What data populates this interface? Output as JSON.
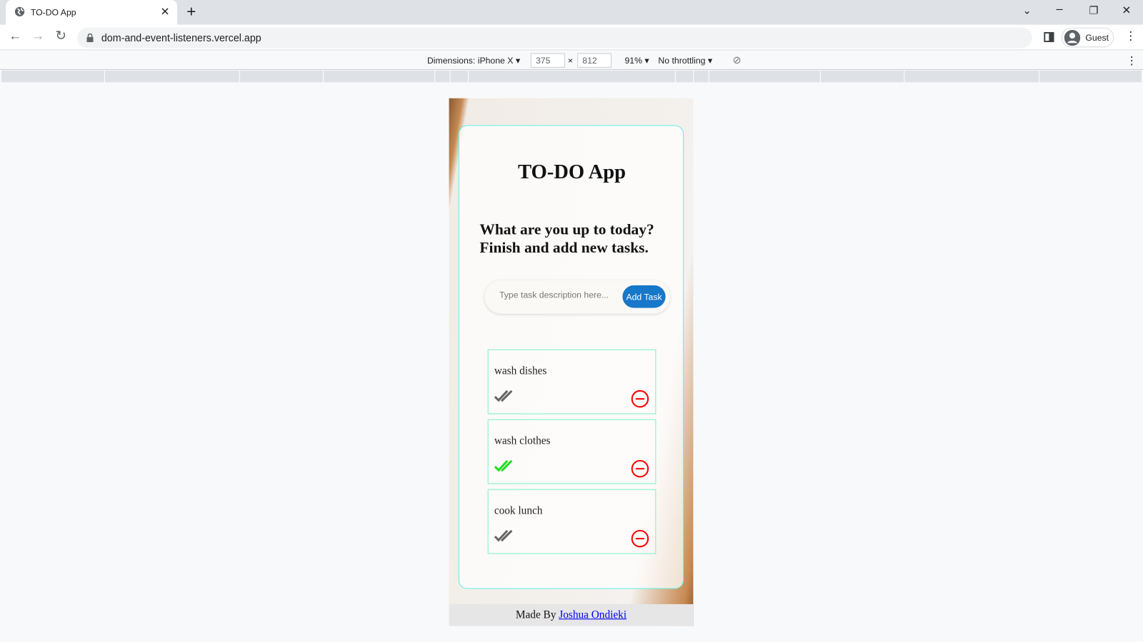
{
  "browser": {
    "tab_title": "TO-DO App",
    "url": "dom-and-event-listeners.vercel.app",
    "profile": "Guest"
  },
  "devtools": {
    "dimensions_label": "Dimensions: iPhone X",
    "width": "375",
    "height": "812",
    "times": "×",
    "zoom": "91%",
    "throttling": "No throttling"
  },
  "app": {
    "title": "TO-DO App",
    "subtitle": "What are you up to today? Finish and add new tasks.",
    "input_placeholder": "Type task description here...",
    "input_value": "",
    "add_button": "Add Task",
    "tasks": [
      {
        "description": "wash dishes",
        "completed": false
      },
      {
        "description": "wash clothes",
        "completed": true
      },
      {
        "description": "cook lunch",
        "completed": false
      }
    ],
    "footer_prefix": "Made By",
    "footer_link": "Joshua Ondieki"
  },
  "colors": {
    "accent": "#1777c9",
    "remove": "#ff0000",
    "done": "#22dd22",
    "pending": "#666666",
    "card_border": "#5ef1e6"
  }
}
